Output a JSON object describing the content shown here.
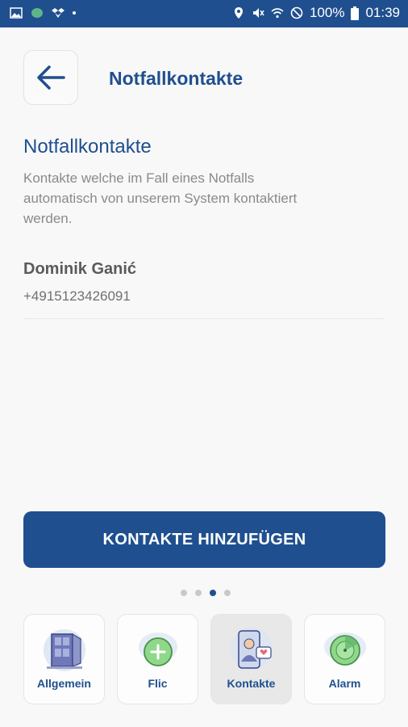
{
  "status_bar": {
    "battery": "100%",
    "time": "01:39"
  },
  "header": {
    "title": "Notfallkontakte",
    "back_icon": "arrow-left-icon"
  },
  "section": {
    "title": "Notfallkontakte",
    "description": "Kontakte welche im Fall eines Notfalls automatisch von unserem System kontaktiert werden."
  },
  "contacts": [
    {
      "name": "Dominik Ganić",
      "phone": "+4915123426091"
    }
  ],
  "add_button": {
    "label": "KONTAKTE HINZUFÜGEN"
  },
  "pager": {
    "count": 4,
    "active": 3
  },
  "tabs": [
    {
      "label": "Allgemein",
      "icon": "door-illustration-icon"
    },
    {
      "label": "Flic",
      "icon": "flic-button-icon"
    },
    {
      "label": "Kontakte",
      "icon": "contact-phone-icon",
      "selected": true
    },
    {
      "label": "Alarm",
      "icon": "alarm-radar-icon"
    }
  ],
  "colors": {
    "primary": "#1f4f8f",
    "text_gray": "#8a8a8a",
    "background": "#f8f8f8"
  }
}
